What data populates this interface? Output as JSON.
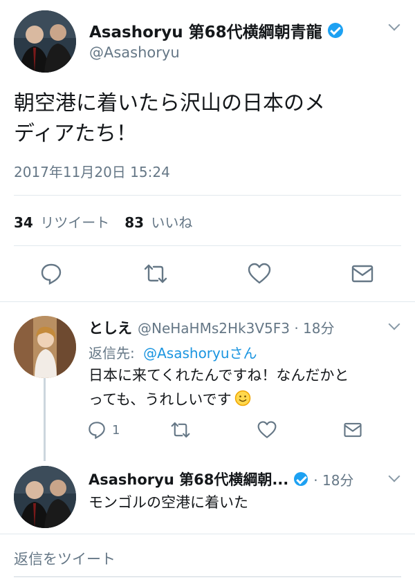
{
  "main_tweet": {
    "display_name": "Asashoryu 第68代横綱朝青龍",
    "handle": "@Asashoryu",
    "text_line1": "朝空港に着いたら沢山の日本のメ",
    "text_line2": "ディアたち！",
    "timestamp": "2017年11月20日 15:24",
    "retweet_count": "34",
    "retweet_label": "リツイート",
    "like_count": "83",
    "like_label": "いいね"
  },
  "reply1": {
    "display_name": "としえ",
    "handle_time": "@NeHaHMs2Hk3V5F3 · 18分",
    "reply_to_prefix": "返信先:",
    "reply_to_handle": "@Asashoryuさん",
    "text_line1": "日本に来てくれたんですね！なんだかと",
    "text_line2": "っても、うれしいです",
    "reply_count": "1"
  },
  "reply2": {
    "display_name": "Asashoryu 第68代横綱朝...",
    "time": "· 18分",
    "text": "モンゴルの空港に着いた"
  },
  "compose": {
    "placeholder": "返信をツイート"
  },
  "colors": {
    "accent": "#1da1f2",
    "secondary_text": "#657786",
    "divider": "#e1e8ed"
  }
}
